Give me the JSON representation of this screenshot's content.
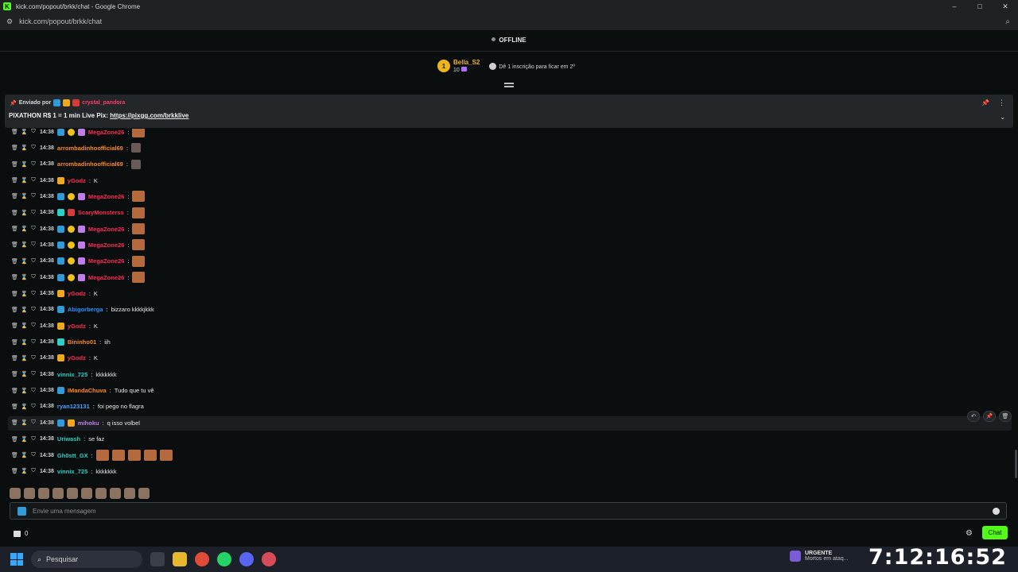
{
  "browser": {
    "title": "kick.com/popout/brkk/chat - Google Chrome",
    "url": "kick.com/popout/brkk/chat",
    "window_controls": [
      "–",
      "□",
      "✕"
    ]
  },
  "stream": {
    "status": "OFFLINE"
  },
  "sub_goal": {
    "rank": "1",
    "name": "Bella_S2",
    "count": "10",
    "info": "Dê 1 inscrição para ficar em 2º"
  },
  "pinned": {
    "sent_by_label": "Enviado por",
    "sender": "crystal_pandora",
    "message_prefix": "PIXATHON R$ 1 = 1 min Live Pix:",
    "link": "https://pixgg.com/brkklive"
  },
  "messages": [
    {
      "time": "14:38",
      "badges": [
        "blue",
        "coin",
        "gift"
      ],
      "user": "MegaZone26",
      "color": "#ff2d55",
      "text": "",
      "emotes": 1
    },
    {
      "time": "14:38",
      "badges": [],
      "user": "arrombadinhoofficial69",
      "color": "#ff8a1c",
      "text": "",
      "emotes": 0,
      "small_emote": true
    },
    {
      "time": "14:38",
      "badges": [],
      "user": "arrombadinhoofficial69",
      "color": "#ff8a1c",
      "text": "",
      "emotes": 0,
      "small_emote": true
    },
    {
      "time": "14:38",
      "badges": [
        "gold"
      ],
      "user": "yGodz",
      "color": "#ff2d55",
      "text": "K",
      "emotes": 0
    },
    {
      "time": "14:38",
      "badges": [
        "blue",
        "coin",
        "gift"
      ],
      "user": "MegaZone26",
      "color": "#ff2d55",
      "text": "",
      "emotes": 1
    },
    {
      "time": "14:38",
      "badges": [
        "cyan",
        "red"
      ],
      "user": "ScaryMonsterss",
      "color": "#ff2d55",
      "text": "",
      "emotes": 1
    },
    {
      "time": "14:38",
      "badges": [
        "blue",
        "coin",
        "gift"
      ],
      "user": "MegaZone26",
      "color": "#ff2d55",
      "text": "",
      "emotes": 1
    },
    {
      "time": "14:38",
      "badges": [
        "blue",
        "coin",
        "gift"
      ],
      "user": "MegaZone26",
      "color": "#ff2d55",
      "text": "",
      "emotes": 1
    },
    {
      "time": "14:38",
      "badges": [
        "blue",
        "coin",
        "gift"
      ],
      "user": "MegaZone26",
      "color": "#ff2d55",
      "text": "",
      "emotes": 1
    },
    {
      "time": "14:38",
      "badges": [
        "blue",
        "coin",
        "gift"
      ],
      "user": "MegaZone26",
      "color": "#ff2d55",
      "text": "",
      "emotes": 1
    },
    {
      "time": "14:38",
      "badges": [
        "gold"
      ],
      "user": "yGodz",
      "color": "#ff2d55",
      "text": "K",
      "emotes": 0
    },
    {
      "time": "14:38",
      "badges": [
        "blue"
      ],
      "user": "Abigorberga",
      "color": "#2f8fff",
      "text": "bizzaro kkkkjkkk",
      "emotes": 0
    },
    {
      "time": "14:38",
      "badges": [
        "gold"
      ],
      "user": "yGodz",
      "color": "#ff2d55",
      "text": "K",
      "emotes": 0
    },
    {
      "time": "14:38",
      "badges": [
        "cyan"
      ],
      "user": "Bininho01",
      "color": "#ff8a1c",
      "text": "iih",
      "emotes": 0
    },
    {
      "time": "14:38",
      "badges": [
        "gold"
      ],
      "user": "yGodz",
      "color": "#ff2d55",
      "text": "K",
      "emotes": 0
    },
    {
      "time": "14:38",
      "badges": [],
      "user": "vinnix_725",
      "color": "#2dd0c6",
      "text": "kkkkkkk",
      "emotes": 0
    },
    {
      "time": "14:38",
      "badges": [
        "blue"
      ],
      "user": "IMandaChuva",
      "color": "#ff8a1c",
      "text": "Tudo que tu vê",
      "emotes": 0
    },
    {
      "time": "14:38",
      "badges": [],
      "user": "ryan123131",
      "color": "#4da3ff",
      "text": "foi pego no flagra",
      "emotes": 0
    },
    {
      "time": "14:38",
      "badges": [
        "blue",
        "gold"
      ],
      "user": "mihoku",
      "color": "#c07fe8",
      "text": "q isso volbel",
      "emotes": 0
    },
    {
      "time": "14:38",
      "badges": [],
      "user": "Uriwash",
      "color": "#2dd0c6",
      "text": "se faz",
      "emotes": 0
    },
    {
      "time": "14:38",
      "badges": [],
      "user": "Gh0stt_GX",
      "color": "#2dd0c6",
      "text": "",
      "emotes": 5
    },
    {
      "time": "14:38",
      "badges": [],
      "user": "vinnix_725",
      "color": "#2dd0c6",
      "text": "kkkkkkk",
      "emotes": 0
    }
  ],
  "input": {
    "placeholder": "Envie uma mensagem"
  },
  "footer": {
    "points": "0",
    "chat_button": "Chat"
  },
  "taskbar": {
    "search": "Pesquisar",
    "news_title": "URGENTE",
    "news_sub": "Mortos em ataq...",
    "clock": "7:12:16:52"
  }
}
